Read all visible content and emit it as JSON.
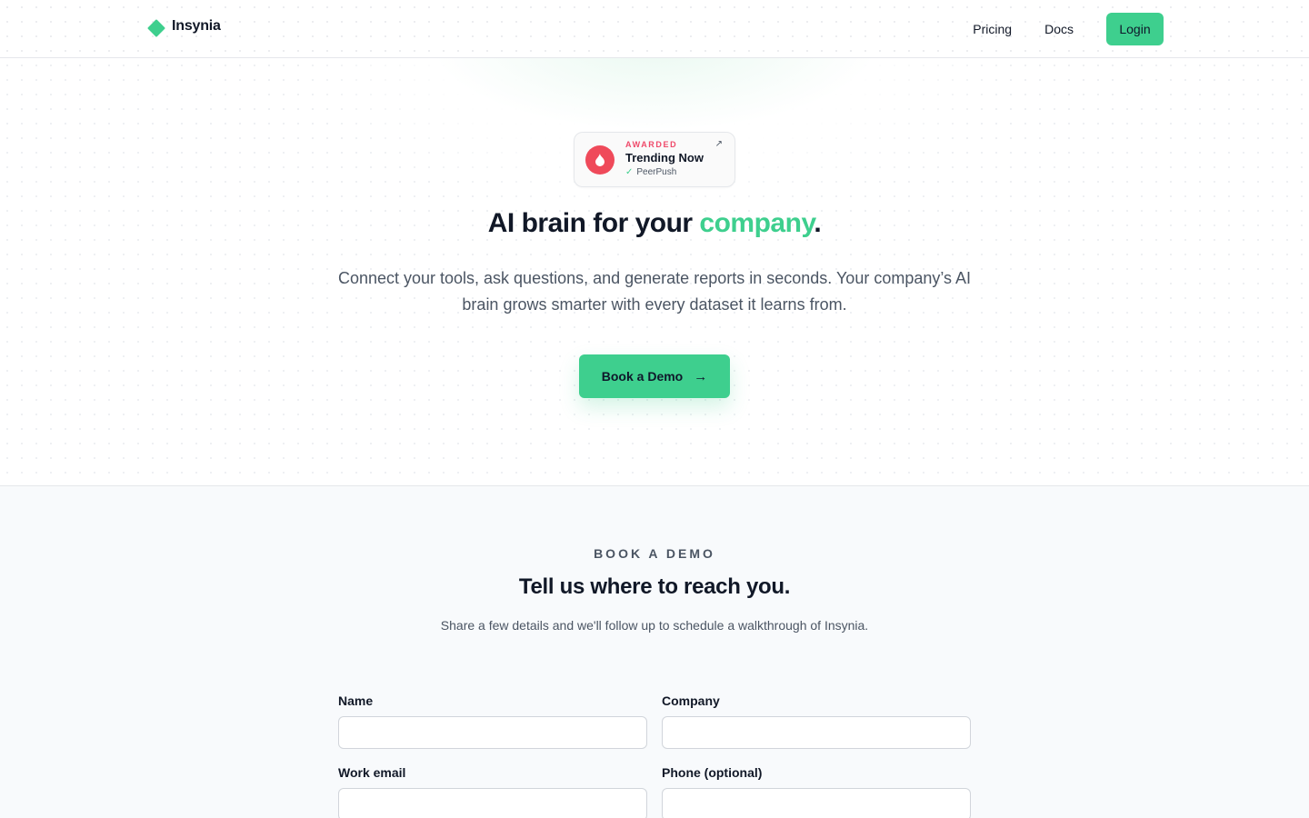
{
  "header": {
    "brand": "Insynia",
    "nav": {
      "pricing": "Pricing",
      "docs": "Docs",
      "login": "Login"
    }
  },
  "hero": {
    "award": {
      "tag": "AWARDED",
      "title": "Trending Now",
      "source": "PeerPush",
      "icons": {
        "logo": "flame-icon",
        "check": "check-icon",
        "external": "arrow-up-right-icon"
      }
    },
    "title_prefix": "AI brain for your ",
    "title_accent": "company",
    "title_suffix": ".",
    "subtitle": "Connect your tools, ask questions, and generate reports in seconds. Your company’s AI brain grows smarter with every dataset it learns from.",
    "cta": {
      "label": "Book a Demo",
      "icon": "arrow-right-icon"
    }
  },
  "form": {
    "eyebrow": "BOOK A DEMO",
    "title": "Tell us where to reach you.",
    "description": "Share a few details and we'll follow up to schedule a walkthrough of Insynia.",
    "fields": {
      "name": {
        "label": "Name",
        "value": ""
      },
      "company": {
        "label": "Company",
        "value": ""
      },
      "email": {
        "label": "Work email",
        "value": ""
      },
      "phone": {
        "label": "Phone (optional)",
        "value": ""
      }
    }
  },
  "colors": {
    "accent": "#3ecf8e",
    "award_red": "#ef4a5a",
    "text_dark": "#111827",
    "text_muted": "#4b5563"
  }
}
